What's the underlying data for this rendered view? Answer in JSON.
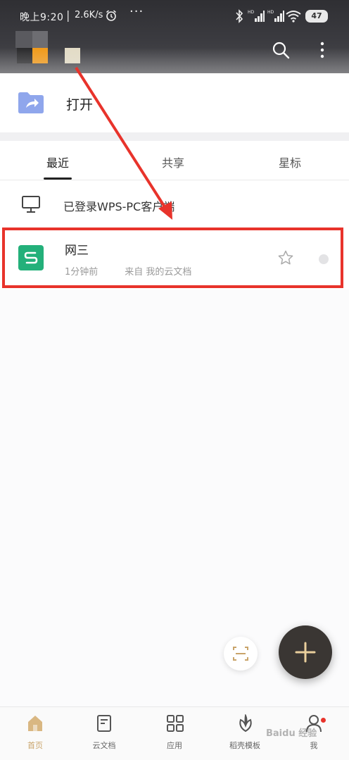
{
  "status_bar": {
    "time": "晚上9:20",
    "separator": "|",
    "speed": "2.6K/s",
    "dots": "···",
    "battery": "47"
  },
  "header": {
    "search_icon": "search-icon",
    "more_icon": "more-vertical-icon"
  },
  "open_row": {
    "label": "打开",
    "icon": "folder-share-icon"
  },
  "tabs": [
    {
      "label": "最近"
    },
    {
      "label": "共享"
    },
    {
      "label": "星标"
    }
  ],
  "pc_login": {
    "label": "已登录WPS-PC客户端",
    "icon": "monitor-icon"
  },
  "recent_files": [
    {
      "name": "网三",
      "time": "1分钟前",
      "source": "来自  我的云文档",
      "icon_letter": "S",
      "icon_color": "#23b07a"
    }
  ],
  "fab": {
    "icon": "plus-icon"
  },
  "scan": {
    "icon": "scan-icon"
  },
  "bottom_nav": [
    {
      "label": "首页",
      "icon": "home-icon",
      "active": true
    },
    {
      "label": "云文档",
      "icon": "cloud-doc-icon"
    },
    {
      "label": "应用",
      "icon": "apps-grid-icon"
    },
    {
      "label": "稻壳模板",
      "icon": "leaf-icon"
    },
    {
      "label": "我",
      "icon": "user-icon"
    }
  ],
  "watermark": "Baidu 经验",
  "colors": {
    "accent_gold": "#c9a46a",
    "annotation_red": "#e8332b",
    "spreadsheet_green": "#23b07a",
    "header_dark": "#3b3b40"
  }
}
